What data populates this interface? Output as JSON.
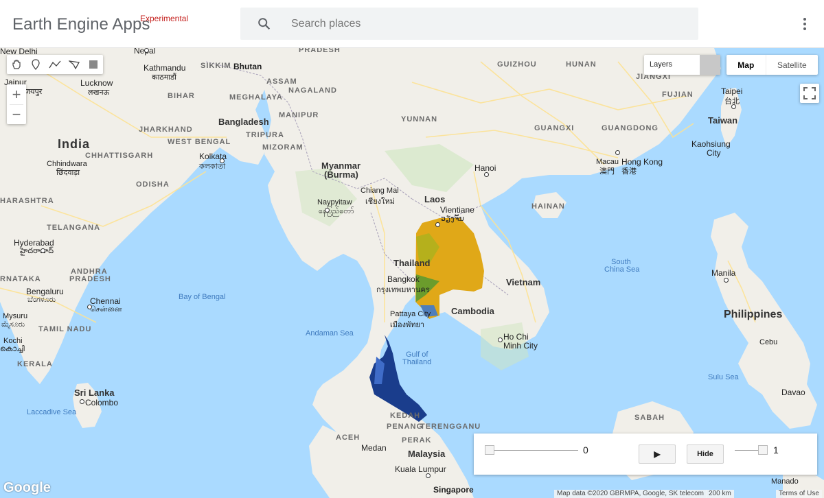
{
  "header": {
    "title": "Earth Engine Apps",
    "badge": "Experimental",
    "search_placeholder": "Search places",
    "more_icon": "more-vert-icon"
  },
  "map_controls": {
    "drawing_tools": [
      "hand-icon",
      "marker-icon",
      "line-icon",
      "polygon-icon",
      "rectangle-icon"
    ],
    "zoom_in": "+",
    "zoom_out": "−",
    "layers_label": "Layers",
    "map_type": {
      "options": [
        "Map",
        "Satellite"
      ],
      "selected": "Map"
    },
    "fullscreen_icon": "fullscreen-icon"
  },
  "map_labels": {
    "countries": [
      {
        "text": "India"
      },
      {
        "text": "Bangladesh"
      },
      {
        "text": "Myanmar"
      },
      {
        "text": "(Burma)"
      },
      {
        "text": "Laos"
      },
      {
        "text": "Thailand"
      },
      {
        "text": "Vietnam"
      },
      {
        "text": "Cambodia"
      },
      {
        "text": "Malaysia"
      },
      {
        "text": "Philippines"
      },
      {
        "text": "Sri Lanka"
      },
      {
        "text": "Taiwan"
      },
      {
        "text": "Nepal"
      },
      {
        "text": "Bhutan"
      }
    ],
    "regions": [
      "PRADESH",
      "SIKKIM",
      "ASSAM",
      "NAGALAND",
      "MEGHALAYA",
      "MANIPUR",
      "BIHAR",
      "JHARKHAND",
      "WEST BENGAL",
      "TRIPURA",
      "MIZORAM",
      "CHHATTISGARH",
      "ODISHA",
      "HARASHTRA",
      "TELANGANA",
      "ANDHRA",
      "PRADESH",
      "RNATAKA",
      "TAMIL NADU",
      "KERALA",
      "YUNNAN",
      "GUIZHOU",
      "HUNAN",
      "JIANGXI",
      "FUJIAN",
      "GUANGXI",
      "GUANGDONG",
      "HAINAN",
      "KEDAH",
      "PENANG",
      "TERENGGANU",
      "PERAK",
      "ACEH",
      "SABAH"
    ],
    "cities": [
      "New Delhi",
      "Kathmandu",
      "काठमाडौं",
      "Jaipur",
      "जयपुर",
      "Lucknow",
      "लखनऊ",
      "Kolkata",
      "কলকাতা",
      "Chhindwara",
      "छिंदवाड़ा",
      "Hyderabad",
      "హైదరాబాద్",
      "Bengaluru",
      "ಬೆಂಗಳೂರು",
      "Chennai",
      "சென்னை",
      "Mysuru",
      "ಮೈಸೂರು",
      "Kochi",
      "കൊച്ചി",
      "Colombo",
      "Naypyitaw",
      "နေပြည်တော်",
      "Chiang Mai",
      "เชียงใหม่",
      "Vientiane",
      "ວຽງຈັນ",
      "Bangkok",
      "กรุงเทพมหานคร",
      "Pattaya City",
      "เมืองพัทยา",
      "Hanoi",
      "Ho Chi",
      "Minh City",
      "Macau",
      "澳門",
      "Hong Kong",
      "香港",
      "Taipei",
      "台北",
      "Kaohsiung",
      "City",
      "Manila",
      "Cebu",
      "Davao",
      "Medan",
      "Kuala Lumpur",
      "Singapore",
      "Manado"
    ],
    "water": [
      "Bay of Bengal",
      "Andaman Sea",
      "Gulf of",
      "Thailand",
      "South",
      "China Sea",
      "Sulu Sea",
      "Laccadive Sea"
    ]
  },
  "overlay_panel": {
    "left_slider_value": "0",
    "play_button": "▶",
    "hide_button": "Hide",
    "right_slider_value": "1",
    "left_slider_fraction": 0,
    "right_slider_fraction": 1
  },
  "footer": {
    "google_logo": "Google",
    "map_data": "Map data ©2020 GBRMPA, Google, SK telecom",
    "scale": "200 km",
    "terms": "Terms of Use"
  },
  "colors": {
    "land": "#f1efe9",
    "water": "#aadaff",
    "roads": "#fde293",
    "overlay_yellow": "#e0a818",
    "overlay_blue": "#1a3d8c"
  }
}
